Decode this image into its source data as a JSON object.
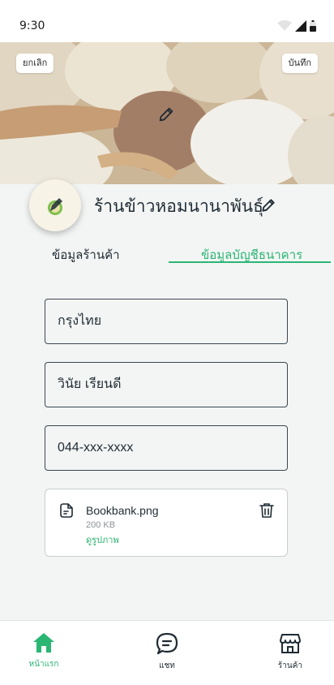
{
  "status_bar": {
    "time": "9:30"
  },
  "header": {
    "cancel_label": "ยกเลิก",
    "save_label": "บันทึก"
  },
  "shop": {
    "name": "ร้านข้าวหอมนานาพันธุ์"
  },
  "tabs": [
    {
      "label": "ข้อมูลร้านค้า",
      "active": false
    },
    {
      "label": "ข้อมูลบัญชีธนาคาร",
      "active": true
    }
  ],
  "form": {
    "bank": "กรุงไทย",
    "account_name": "วินัย เรียนดี",
    "account_number": "044-xxx-xxxx"
  },
  "attachment": {
    "file_name": "Bookbank.png",
    "file_size": "200 KB",
    "view_label": "ดูรูปภาพ"
  },
  "bottom_nav": [
    {
      "label": "หน้าแรก",
      "icon": "home-icon",
      "active": true
    },
    {
      "label": "แชท",
      "icon": "chat-icon",
      "active": false
    },
    {
      "label": "ร้านค้า",
      "icon": "store-icon",
      "active": false
    }
  ],
  "colors": {
    "accent": "#2bb673",
    "text": "#1f2b33",
    "background": "#f3f5f4"
  }
}
